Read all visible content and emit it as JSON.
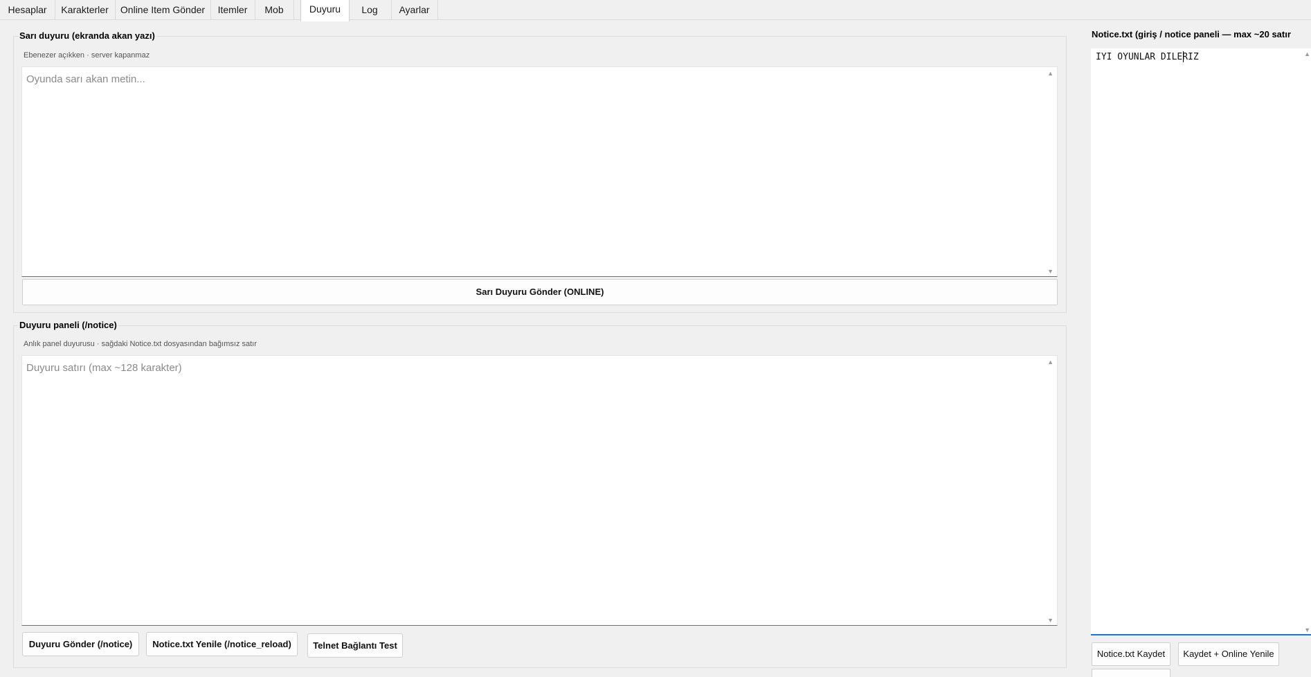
{
  "tabs": [
    {
      "label": "Hesaplar"
    },
    {
      "label": "Karakterler"
    },
    {
      "label": "Online Item Gönder"
    },
    {
      "label": "Itemler"
    },
    {
      "label": "Mob"
    },
    {
      "label": "Duyuru",
      "active": true
    },
    {
      "label": "Log"
    },
    {
      "label": "Ayarlar"
    }
  ],
  "yellow_notice": {
    "title": "Sarı duyuru (ekranda akan yazı)",
    "subtitle": "Ebenezer açıkken · server kapanmaz",
    "placeholder": "Oyunda sarı akan metin...",
    "send_button": "Sarı Duyuru Gönder (ONLINE)"
  },
  "notice_panel": {
    "title": "Duyuru paneli (/notice)",
    "subtitle": "Anlık panel duyurusu · sağdaki Notice.txt dosyasından bağımsız satır",
    "placeholder": "Duyuru satırı (max ~128 karakter)",
    "buttons": {
      "send": "Duyuru Gönder (/notice)",
      "reload": "Notice.txt Yenile (/notice_reload)",
      "telnet": "Telnet Bağlantı Test"
    }
  },
  "notice_file": {
    "title": "Notice.txt (giriş / notice paneli — max ~20 satır",
    "content": "IYI OYUNLAR DILERIZ",
    "save_button": "Notice.txt Kaydet",
    "save_reload_button": "Kaydet + Online Yenile"
  },
  "colors": {
    "background": "#f0f0f0",
    "focus_accent": "#1a73d9"
  }
}
